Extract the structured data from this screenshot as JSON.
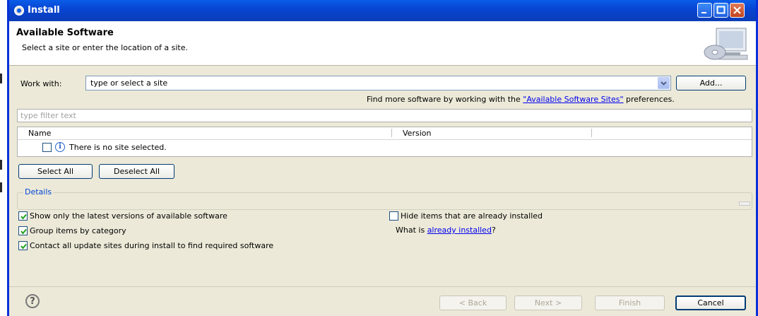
{
  "window": {
    "title": "Install",
    "icon": "gear-icon",
    "controls": [
      "minimize-icon",
      "maximize-icon",
      "close-icon"
    ]
  },
  "header": {
    "title": "Available Software",
    "subtitle": "Select a site or enter the location of a site."
  },
  "work_with": {
    "label": "Work with:",
    "value": "type or select a site",
    "add_label": "Add..."
  },
  "find_more": {
    "prefix": "Find more software by working with the ",
    "link": "\"Available Software Sites\"",
    "suffix": " preferences."
  },
  "filter": {
    "placeholder": "type filter text"
  },
  "table": {
    "columns": [
      "Name",
      "Version"
    ],
    "rows": [
      {
        "checked": false,
        "icon": "info-icon",
        "text": "There is no site selected."
      }
    ]
  },
  "buttons": {
    "select_all": "Select All",
    "deselect_all": "Deselect All",
    "back": "< Back",
    "next": "Next >",
    "finish": "Finish",
    "cancel": "Cancel"
  },
  "details": {
    "legend": "Details"
  },
  "options": {
    "latest_versions": {
      "label": "Show only the latest versions of available software",
      "checked": true
    },
    "group_by_category": {
      "label": "Group items by category",
      "checked": true
    },
    "contact_sites": {
      "label": "Contact all update sites during install to find required software",
      "checked": true
    },
    "hide_installed": {
      "label": "Hide items that are already installed",
      "checked": false
    }
  },
  "what_is": {
    "prefix": "What is ",
    "link": "already installed",
    "suffix": "?"
  },
  "colors": {
    "titlebar": "#0a5de8",
    "link": "#0000ee",
    "legend": "#0046d5"
  }
}
